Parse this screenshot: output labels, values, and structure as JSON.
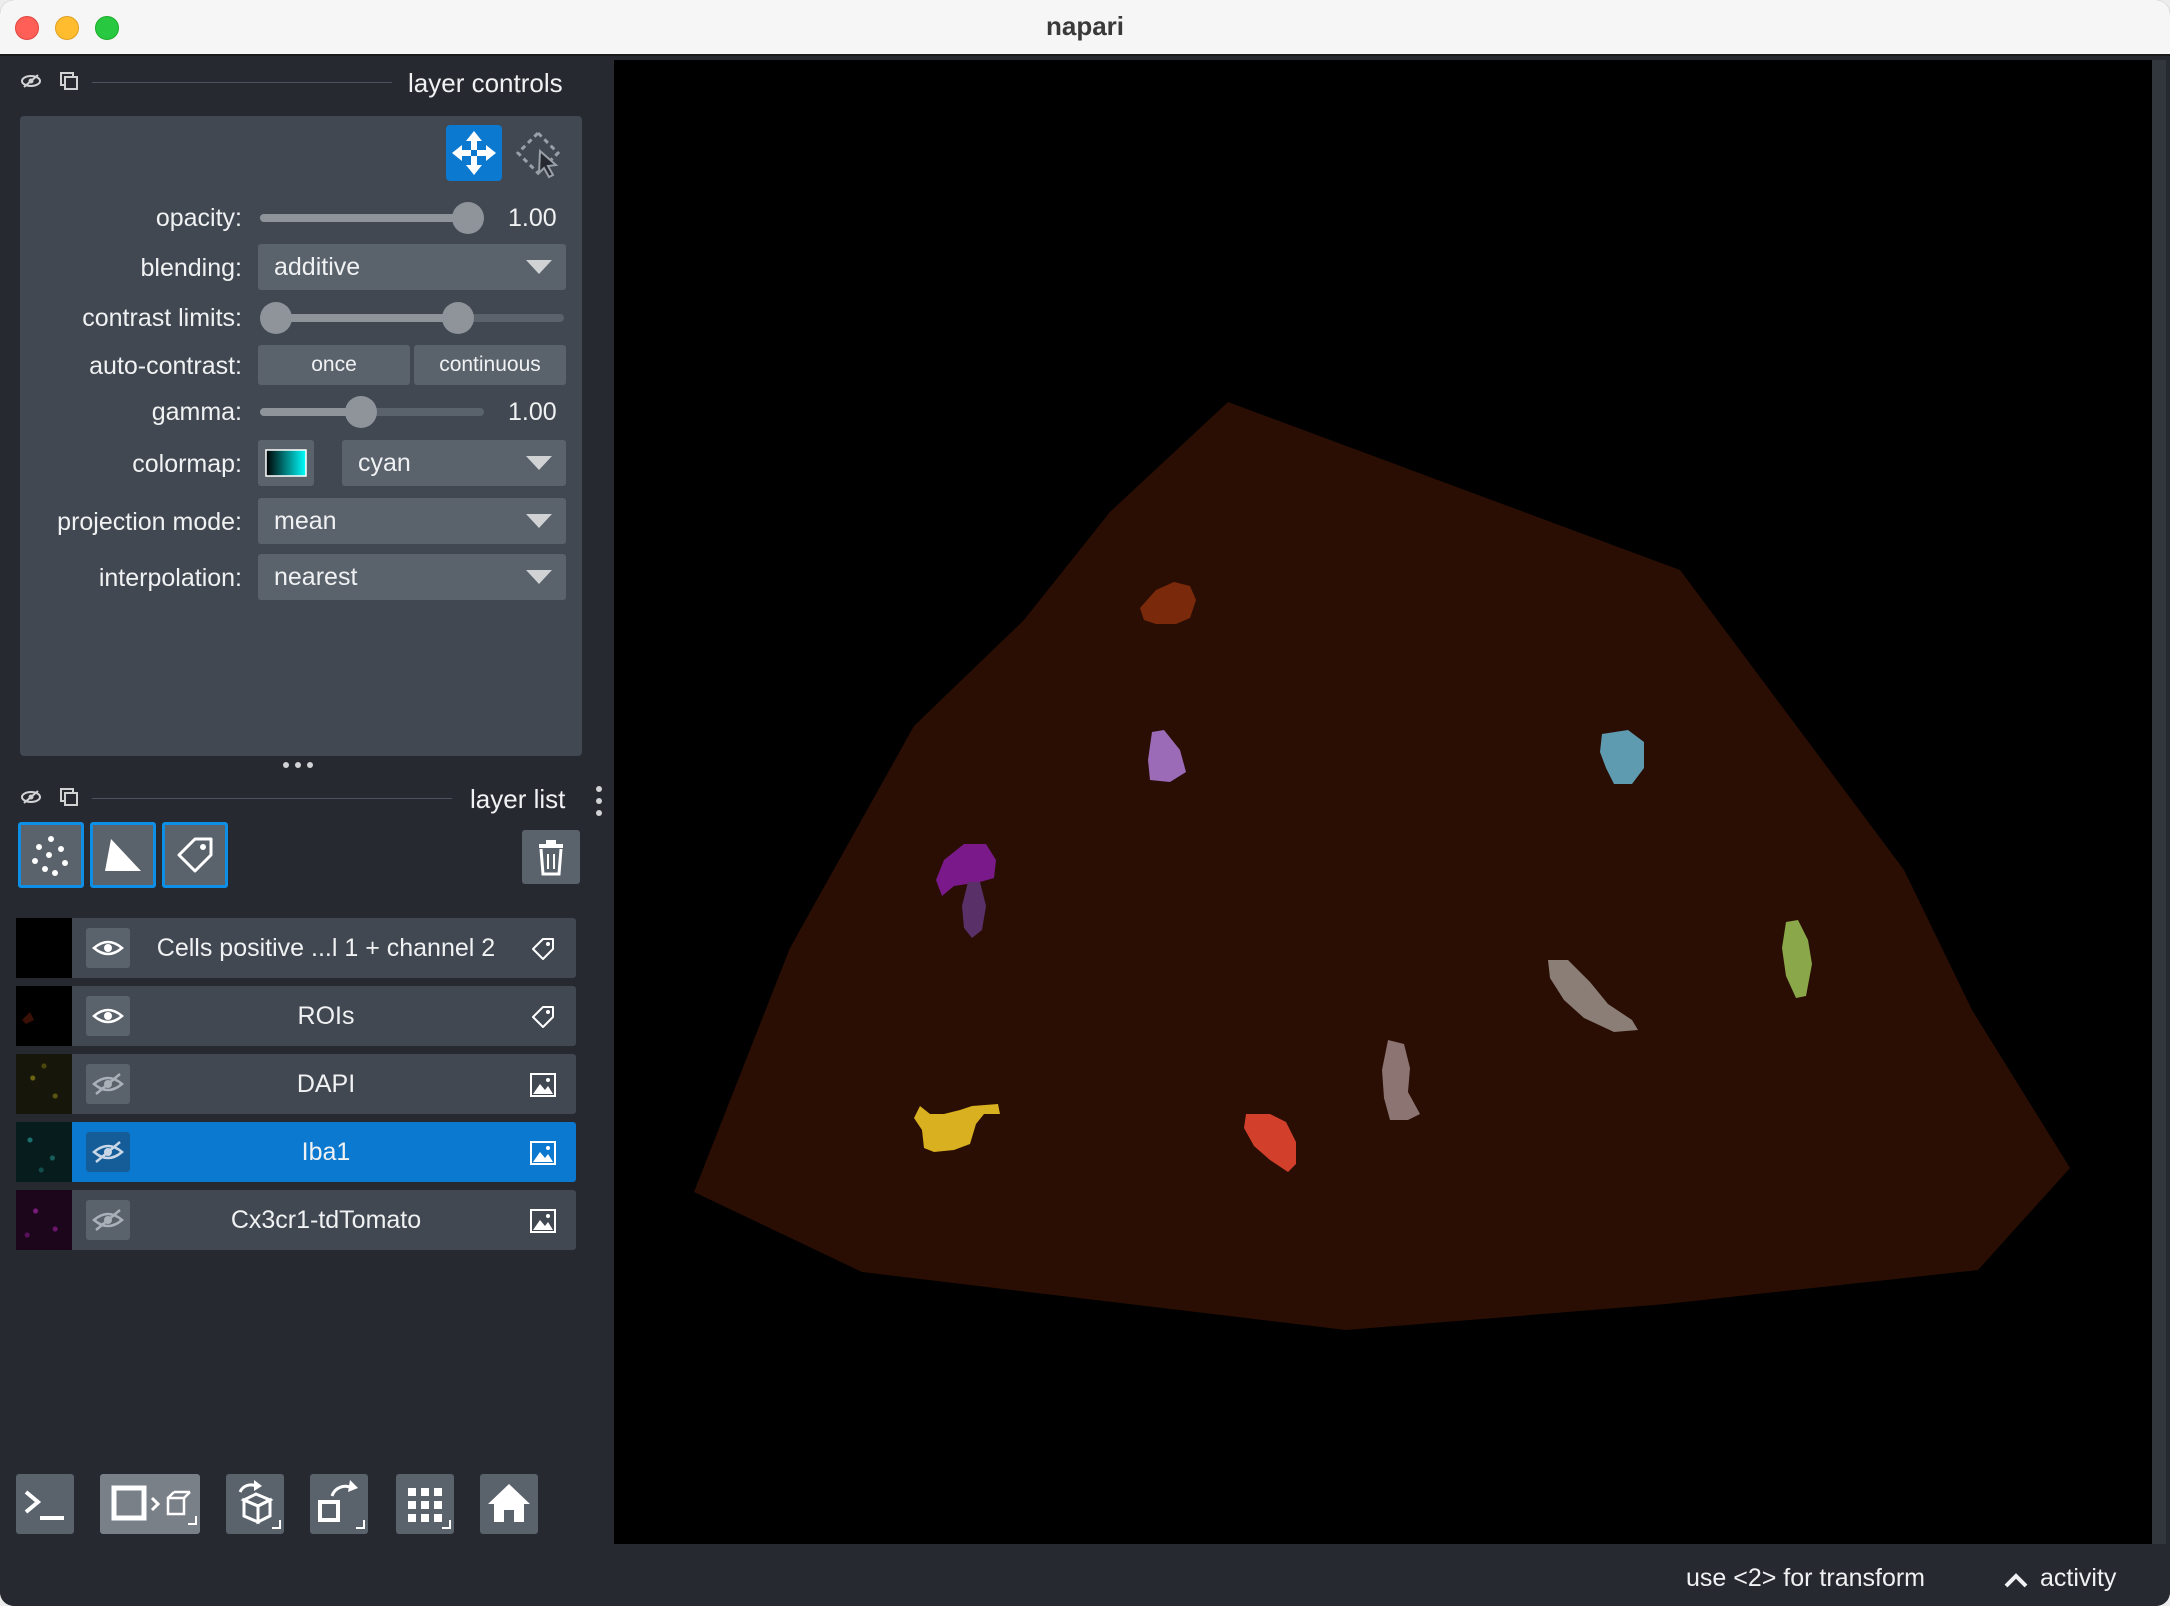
{
  "window": {
    "title": "napari"
  },
  "layer_controls": {
    "header_title": "layer controls",
    "opacity": {
      "label": "opacity:",
      "value": "1.00",
      "level": 1.0
    },
    "blending": {
      "label": "blending:",
      "value": "additive"
    },
    "contrast_limits": {
      "label": "contrast limits:",
      "low": 0.0,
      "high": 0.64
    },
    "auto_contrast": {
      "label": "auto-contrast:",
      "once_label": "once",
      "continuous_label": "continuous"
    },
    "gamma": {
      "label": "gamma:",
      "value": "1.00",
      "level": 0.5
    },
    "colormap": {
      "label": "colormap:",
      "value": "cyan"
    },
    "projection_mode": {
      "label": "projection mode:",
      "value": "mean"
    },
    "interpolation": {
      "label": "interpolation:",
      "value": "nearest"
    },
    "colors": {
      "accent": "#0b79d0",
      "panel": "#414851",
      "control": "#5a626c"
    }
  },
  "layer_list": {
    "header_title": "layer list",
    "layers": [
      {
        "name": "Cells positive ...l 1 + channel 2",
        "type_icon": "label-icon",
        "visible": true,
        "selected": false
      },
      {
        "name": "ROIs",
        "type_icon": "label-icon",
        "visible": true,
        "selected": false
      },
      {
        "name": "DAPI",
        "type_icon": "image-icon",
        "visible": false,
        "selected": false
      },
      {
        "name": "Iba1",
        "type_icon": "image-icon",
        "visible": false,
        "selected": true
      },
      {
        "name": "Cx3cr1-tdTomato",
        "type_icon": "image-icon",
        "visible": false,
        "selected": false
      }
    ]
  },
  "status": {
    "hint": "use <2> for transform",
    "activity_label": "activity"
  }
}
